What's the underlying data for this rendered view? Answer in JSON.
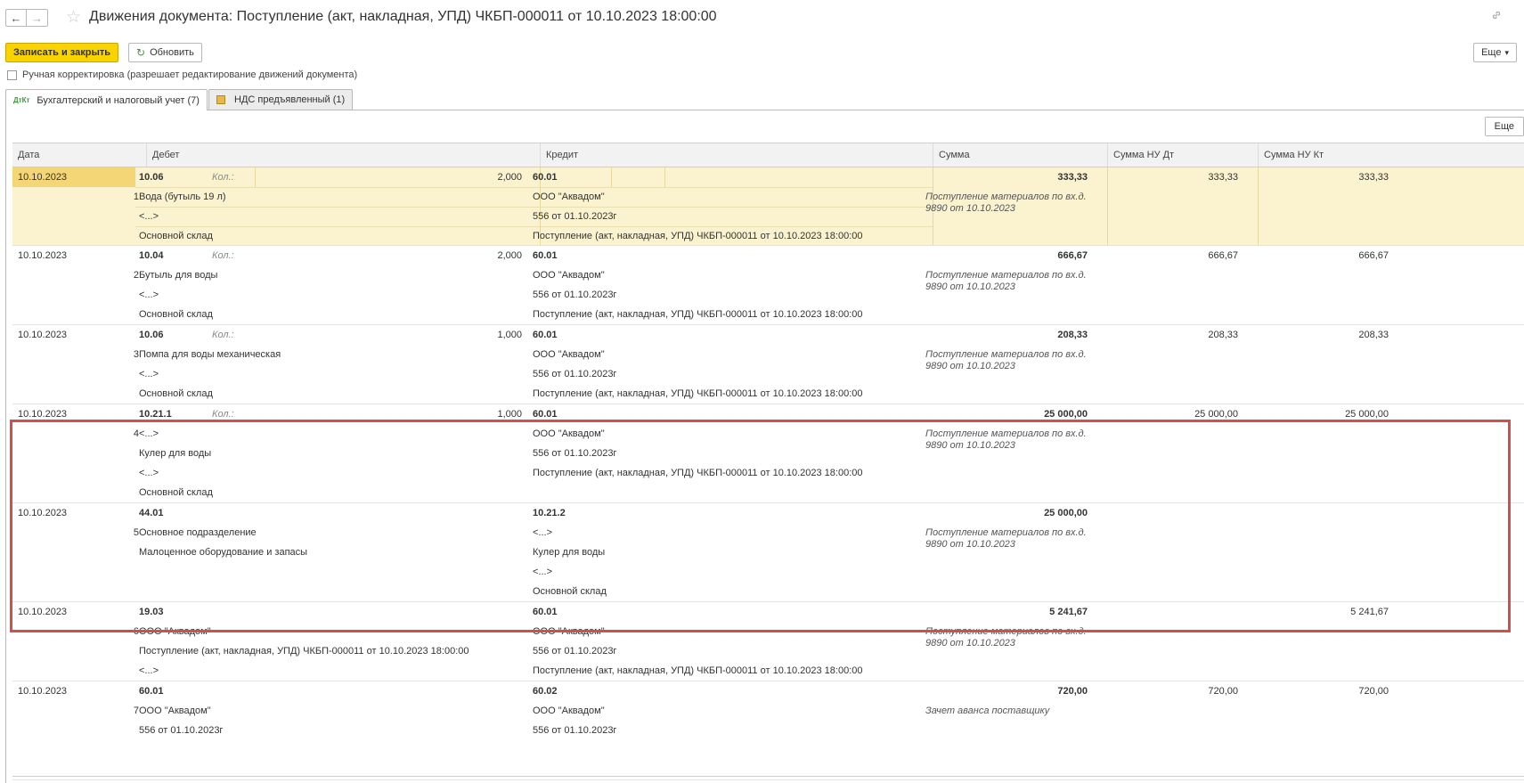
{
  "title": "Движения документа: Поступление (акт, накладная, УПД) ЧКБП-000011 от 10.10.2023 18:00:00",
  "nav": {
    "back": "←",
    "forward": "→",
    "star": "☆",
    "link": "🔗"
  },
  "toolbar": {
    "save_close": "Записать и закрыть",
    "refresh": "Обновить",
    "refresh_icon": "↻",
    "more": "Еще",
    "more_arrow": "▾"
  },
  "manual_edit": "Ручная корректировка (разрешает редактирование движений документа)",
  "tabs": [
    {
      "label": "Бухгалтерский и налоговый учет (7)",
      "icon": "ДтКт"
    },
    {
      "label": "НДС предъявленный (1)"
    }
  ],
  "table_more": "Еще",
  "columns": {
    "date": "Дата",
    "debit": "Дебет",
    "credit": "Кредит",
    "sum": "Сумма",
    "sum_nu_dt": "Сумма НУ Дт",
    "sum_nu_kt": "Сумма НУ Кт"
  },
  "kol_label": "Кол.:",
  "rows": [
    {
      "date": "10.10.2023",
      "n": "1",
      "dt_acc": "10.06",
      "dt_qty": "2,000",
      "dt_lines": [
        "Вода (бутыль 19 л)",
        "<...>",
        "Основной склад"
      ],
      "kt_acc": "60.01",
      "kt_lines": [
        "ООО \"Аквадом\"",
        "556 от 01.10.2023г",
        "Поступление (акт, накладная, УПД) ЧКБП-000011 от 10.10.2023 18:00:00"
      ],
      "sum": "333,33",
      "desc": "Поступление материалов по вх.д. 9890 от 10.10.2023",
      "nu_dt": "333,33",
      "nu_kt": "333,33"
    },
    {
      "date": "10.10.2023",
      "n": "2",
      "dt_acc": "10.04",
      "dt_qty": "2,000",
      "dt_lines": [
        "Бутыль для воды",
        "<...>",
        "Основной склад"
      ],
      "kt_acc": "60.01",
      "kt_lines": [
        "ООО \"Аквадом\"",
        "556 от 01.10.2023г",
        "Поступление (акт, накладная, УПД) ЧКБП-000011 от 10.10.2023 18:00:00"
      ],
      "sum": "666,67",
      "desc": "Поступление материалов по вх.д. 9890 от 10.10.2023",
      "nu_dt": "666,67",
      "nu_kt": "666,67"
    },
    {
      "date": "10.10.2023",
      "n": "3",
      "dt_acc": "10.06",
      "dt_qty": "1,000",
      "dt_lines": [
        "Помпа для воды механическая",
        "<...>",
        "Основной склад"
      ],
      "kt_acc": "60.01",
      "kt_lines": [
        "ООО \"Аквадом\"",
        "556 от 01.10.2023г",
        "Поступление (акт, накладная, УПД) ЧКБП-000011 от 10.10.2023 18:00:00"
      ],
      "sum": "208,33",
      "desc": "Поступление материалов по вх.д. 9890 от 10.10.2023",
      "nu_dt": "208,33",
      "nu_kt": "208,33"
    },
    {
      "date": "10.10.2023",
      "n": "4",
      "dt_acc": "10.21.1",
      "dt_qty": "1,000",
      "dt_lines": [
        "<...>",
        "Кулер для воды",
        "<...>",
        "Основной склад"
      ],
      "kt_acc": "60.01",
      "kt_lines": [
        "ООО \"Аквадом\"",
        "556 от 01.10.2023г",
        "Поступление (акт, накладная, УПД) ЧКБП-000011 от 10.10.2023 18:00:00"
      ],
      "sum": "25 000,00",
      "desc": "Поступление материалов по вх.д. 9890 от 10.10.2023",
      "nu_dt": "25 000,00",
      "nu_kt": "25 000,00"
    },
    {
      "date": "10.10.2023",
      "n": "5",
      "dt_acc": "44.01",
      "dt_qty": "",
      "dt_lines": [
        "Основное подразделение",
        "Малоценное оборудование и запасы"
      ],
      "kt_acc": "10.21.2",
      "kt_lines": [
        "<...>",
        "Кулер для воды",
        "<...>",
        "Основной склад"
      ],
      "sum": "25 000,00",
      "desc": "Поступление материалов по вх.д. 9890 от 10.10.2023",
      "nu_dt": "",
      "nu_kt": ""
    },
    {
      "date": "10.10.2023",
      "n": "6",
      "dt_acc": "19.03",
      "dt_qty": "",
      "dt_lines": [
        "ООО \"Аквадом\"",
        "Поступление (акт, накладная, УПД) ЧКБП-000011 от 10.10.2023 18:00:00",
        "<...>"
      ],
      "kt_acc": "60.01",
      "kt_lines": [
        "ООО \"Аквадом\"",
        "556 от 01.10.2023г",
        "Поступление (акт, накладная, УПД) ЧКБП-000011 от 10.10.2023 18:00:00"
      ],
      "sum": "5 241,67",
      "desc": "Поступление материалов по вх.д. 9890 от 10.10.2023",
      "nu_dt": "",
      "nu_kt": "5 241,67"
    },
    {
      "date": "10.10.2023",
      "n": "7",
      "dt_acc": "60.01",
      "dt_qty": "",
      "dt_lines": [
        "ООО \"Аквадом\"",
        "556 от 01.10.2023г"
      ],
      "kt_acc": "60.02",
      "kt_lines": [
        "ООО \"Аквадом\"",
        "556 от 01.10.2023г"
      ],
      "sum": "720,00",
      "desc": "Зачет аванса поставщику",
      "nu_dt": "720,00",
      "nu_kt": "720,00"
    }
  ]
}
